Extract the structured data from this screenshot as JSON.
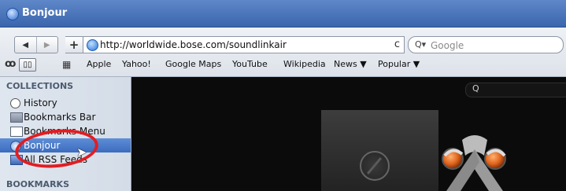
{
  "window": {
    "title": "Bonjour"
  },
  "toolbar": {
    "back_label": "◀",
    "forward_label": "▶",
    "add_label": "+",
    "url": "http://worldwide.bose.com/soundlinkair",
    "reload_label": "c",
    "search_placeholder": "Google"
  },
  "bookmarks_bar": {
    "items": [
      {
        "label": "Apple"
      },
      {
        "label": "Yahoo!"
      },
      {
        "label": "Google Maps"
      },
      {
        "label": "YouTube"
      },
      {
        "label": "Wikipedia"
      },
      {
        "label": "News ▼"
      },
      {
        "label": "Popular ▼"
      }
    ]
  },
  "sidebar": {
    "collections_header": "COLLECTIONS",
    "items": [
      {
        "label": "History",
        "icon": "clock-icon"
      },
      {
        "label": "Bookmarks Bar",
        "icon": "bookmarks-bar-icon"
      },
      {
        "label": "Bookmarks Menu",
        "icon": "bookmarks-menu-icon"
      },
      {
        "label": "Bonjour",
        "icon": "compass-icon",
        "selected": true
      },
      {
        "label": "All RSS Feeds",
        "icon": "rss-icon"
      }
    ],
    "bookmarks_header": "BOOKMARKS"
  },
  "colors": {
    "title_bar": "#3b66ad",
    "selection": "#3b6bbf",
    "annotation_circle": "#e21d22",
    "content_background": "#0b0b0b"
  }
}
